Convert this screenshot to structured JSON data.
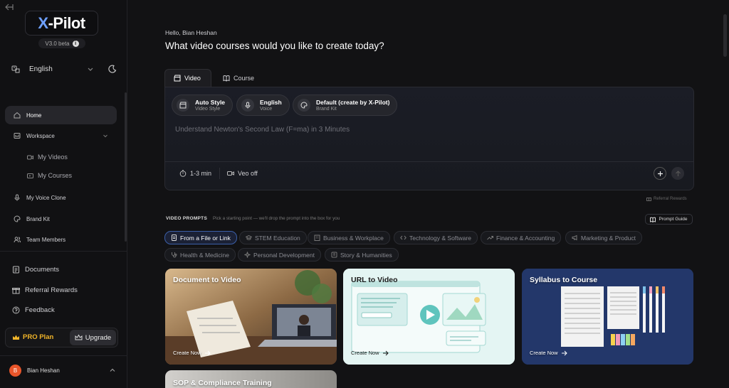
{
  "sidebar": {
    "logo": {
      "x": "X",
      "rest": "-Pilot"
    },
    "version": "V3.0 beta",
    "language": "English",
    "nav": {
      "home": "Home",
      "workspace": "Workspace",
      "my_videos": "My Videos",
      "my_courses": "My Courses",
      "voice_clone": "My Voice Clone",
      "brand_kit": "Brand Kit",
      "team_members": "Team Members",
      "documents": "Documents",
      "referral_rewards": "Referral Rewards",
      "feedback": "Feedback"
    },
    "plan": "PRO Plan",
    "upgrade": "Upgrade",
    "user": {
      "initial": "B",
      "name": "Bian Heshan"
    }
  },
  "main": {
    "greeting": "Hello, Bian Heshan",
    "headline": "What video courses would you like to create today?",
    "tabs": {
      "video": "Video",
      "course": "Course"
    },
    "chips": {
      "style": {
        "title": "Auto Style",
        "sub": "Video Style"
      },
      "voice": {
        "title": "English",
        "sub": "Voice"
      },
      "brand": {
        "title": "Default (create by X-Pilot)",
        "sub": "Brand Kit"
      }
    },
    "prompt_placeholder": "Understand Newton's Second Law (F=ma) in 3 Minutes",
    "duration": "1-3 min",
    "veo": "Veo off",
    "referral_link": "Referral Rewards",
    "section_title": "VIDEO PROMPTS",
    "section_hint": "Pick a starting point — we'll drop the prompt into the box for you",
    "prompt_guide": "Prompt Guide",
    "categories": [
      "From a File or Link",
      "STEM Education",
      "Business & Workplace",
      "Technology & Software",
      "Finance & Accounting",
      "Marketing & Product",
      "Health & Medicine",
      "Personal Development",
      "Story & Humanities"
    ],
    "cards": [
      {
        "title": "Document to Video",
        "cta": "Create Now"
      },
      {
        "title": "URL to Video",
        "cta": "Create Now"
      },
      {
        "title": "Syllabus to Course",
        "cta": "Create Now"
      },
      {
        "title": "SOP & Compliance Training"
      }
    ]
  },
  "colors": {
    "accent": "#3b5fa8",
    "pro": "#f0b429",
    "avatar": "#e8552a"
  }
}
